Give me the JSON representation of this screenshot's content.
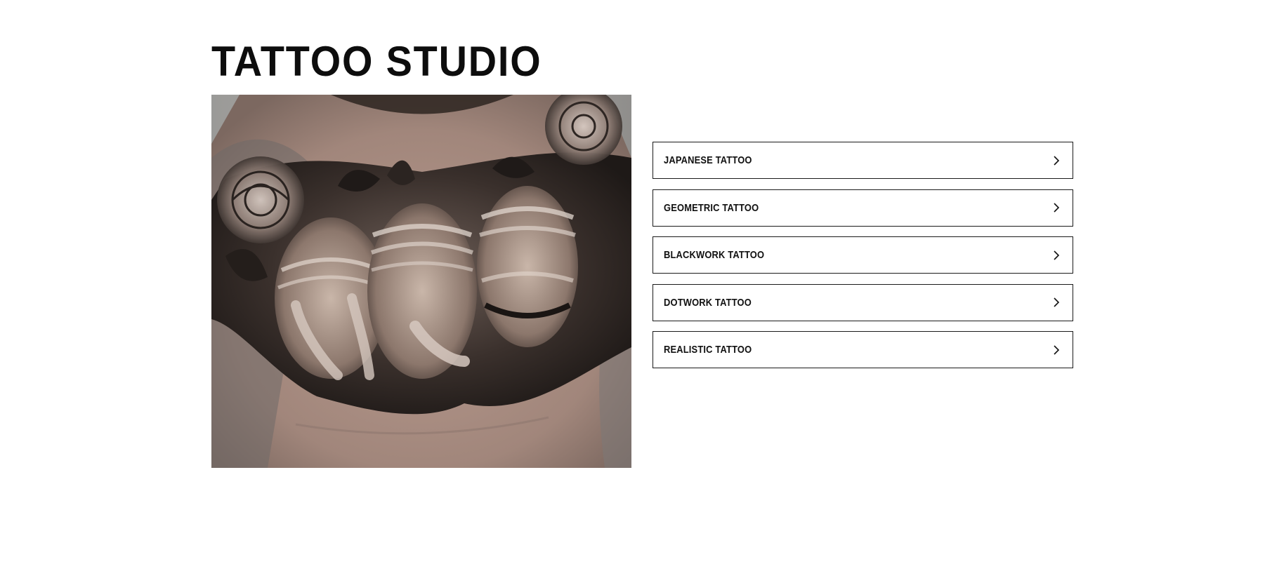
{
  "page": {
    "title": "TATTOO STUDIO"
  },
  "hero": {
    "alt": "Black and grey chest tattoo of three bandaged figures covering eyes, ears and mouth, framed by roses and leaves"
  },
  "categories": [
    {
      "label": "JAPANESE TATTOO",
      "icon": "chevron-right-icon"
    },
    {
      "label": "GEOMETRIC TATTOO",
      "icon": "chevron-right-icon"
    },
    {
      "label": "BLACKWORK TATTOO",
      "icon": "chevron-right-icon"
    },
    {
      "label": "DOTWORK TATTOO",
      "icon": "chevron-right-icon"
    },
    {
      "label": "REALISTIC TATTOO",
      "icon": "chevron-right-icon"
    }
  ],
  "colors": {
    "text": "#111111",
    "border": "#1a1a1a",
    "background": "#ffffff"
  }
}
